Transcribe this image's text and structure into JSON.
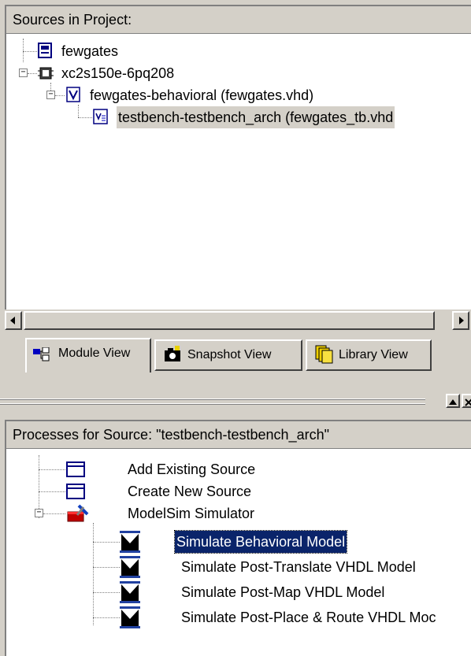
{
  "sources": {
    "header": "Sources in Project:",
    "items": [
      {
        "label": "fewgates",
        "icon": "project-file-icon"
      },
      {
        "label": "xc2s150e-6pq208",
        "icon": "chip-icon"
      },
      {
        "label": "fewgates-behavioral (fewgates.vhd)",
        "icon": "vhdl-file-icon"
      },
      {
        "label": "testbench-testbench_arch (fewgates_tb.vhd",
        "icon": "testbench-icon"
      }
    ]
  },
  "tabs": [
    {
      "label": "Module View",
      "icon": "module-view-icon"
    },
    {
      "label": "Snapshot View",
      "icon": "camera-icon"
    },
    {
      "label": "Library View",
      "icon": "library-icon"
    }
  ],
  "processes": {
    "header": "Processes for Source:  \"testbench-testbench_arch\"",
    "items": [
      {
        "label": "Add Existing Source",
        "icon": "window-icon"
      },
      {
        "label": "Create New Source",
        "icon": "window-icon"
      },
      {
        "label": "ModelSim Simulator",
        "icon": "toolbox-icon"
      },
      {
        "label": "Simulate Behavioral Model",
        "icon": "modelsim-icon"
      },
      {
        "label": "Simulate Post-Translate VHDL Model",
        "icon": "modelsim-icon"
      },
      {
        "label": "Simulate Post-Map VHDL Model",
        "icon": "modelsim-icon"
      },
      {
        "label": "Simulate Post-Place & Route VHDL Moc",
        "icon": "modelsim-icon"
      }
    ]
  },
  "colors": {
    "face": "#d4d0c8",
    "selection": "#0a246a"
  }
}
